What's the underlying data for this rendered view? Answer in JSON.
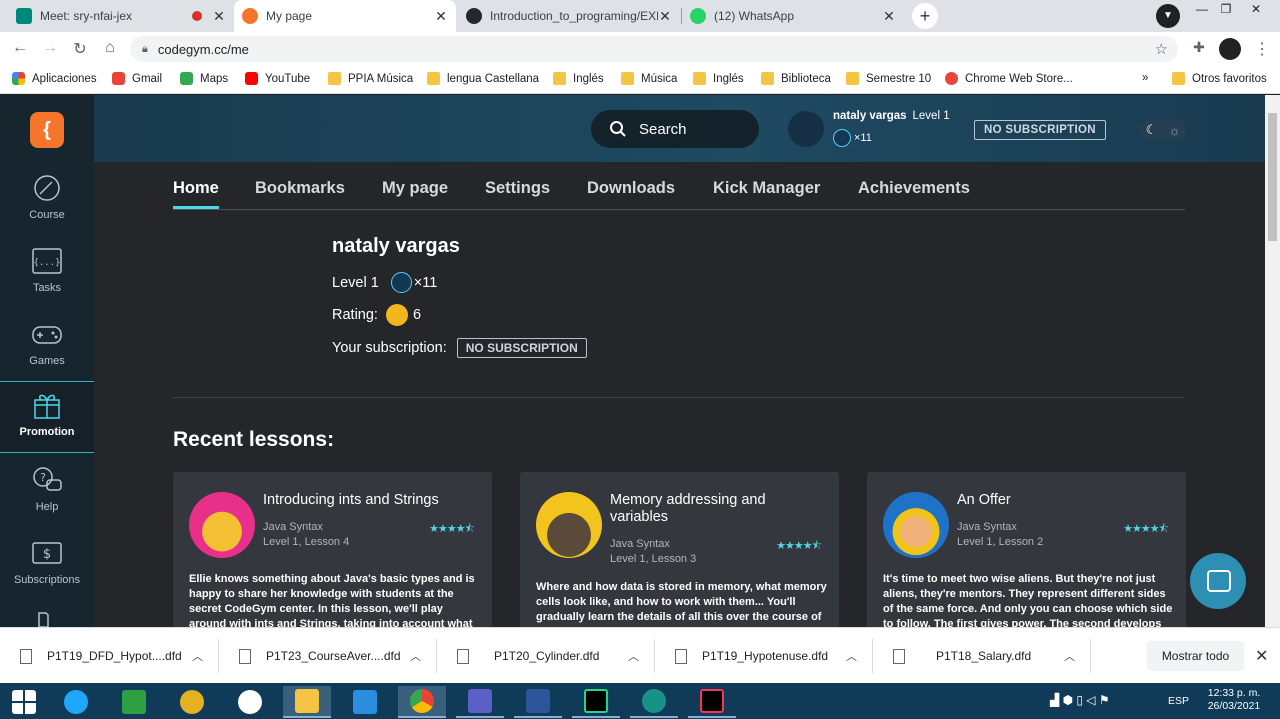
{
  "browser": {
    "tabs": [
      {
        "title": "Meet: sry-nfai-jex",
        "active": false
      },
      {
        "title": "My page",
        "active": true
      },
      {
        "title": "Introduction_to_programing/EXE",
        "active": false
      },
      {
        "title": "(12) WhatsApp",
        "active": false
      }
    ],
    "url": "codegym.cc/me",
    "bookmarks": [
      "Aplicaciones",
      "Gmail",
      "Maps",
      "YouTube",
      "PPIA Música",
      "lengua Castellana",
      "Inglés",
      "Música",
      "Inglés",
      "Biblioteca",
      "Semestre 10",
      "Chrome Web Store..."
    ],
    "more_bookmarks": "»",
    "other_bookmarks": "Otros favoritos"
  },
  "sidebar": {
    "logo": "{",
    "items": [
      {
        "label": "Course"
      },
      {
        "label": "Tasks"
      },
      {
        "label": "Games"
      },
      {
        "label": "Promotion"
      },
      {
        "label": "Help"
      },
      {
        "label": "Subscriptions"
      }
    ]
  },
  "header": {
    "search_label": "Search",
    "user_name": "nataly vargas",
    "user_level": "Level 1",
    "user_coins": "×11",
    "subscription": "NO SUBSCRIPTION"
  },
  "nav": {
    "tabs": [
      "Home",
      "Bookmarks",
      "My page",
      "Settings",
      "Downloads",
      "Kick Manager",
      "Achievements"
    ]
  },
  "profile": {
    "name": "nataly vargas",
    "level_label": "Level 1",
    "coins": "×11",
    "rating_label": "Rating:",
    "rating_value": "6",
    "subscription_label": "Your subscription:",
    "subscription_value": "NO SUBSCRIPTION"
  },
  "recent": {
    "title": "Recent lessons:",
    "lessons": [
      {
        "title": "Introducing ints and Strings",
        "course": "Java Syntax",
        "position": "Level 1, Lesson 4",
        "stars": "★★★★⯪",
        "description": "Ellie knows something about Java's basic types and is happy to share her knowledge with students at the secret CodeGym center. In this lesson, we'll play around with ints and Strings, taking into account what you previously"
      },
      {
        "title": "Memory addressing and variables",
        "course": "Java Syntax",
        "position": "Level 1, Lesson 3",
        "stars": "★★★★⯪",
        "description": "Where and how data is stored in memory, what memory cells look like, and how to work with them... You'll gradually learn the details of all this over the course of"
      },
      {
        "title": "An Offer",
        "course": "Java Syntax",
        "position": "Level 1, Lesson 2",
        "stars": "★★★★⯪",
        "description": "It's time to meet two wise aliens. But they're not just aliens, they're mentors. They represent different sides of the same force. And only you can choose which side to follow. The first gives power. The second develops"
      }
    ]
  },
  "downloads": {
    "files": [
      "P1T19_DFD_Hypot....dfd",
      "P1T23_CourseAver....dfd",
      "P1T20_Cylinder.dfd",
      "P1T19_Hypotenuse.dfd",
      "P1T18_Salary.dfd"
    ],
    "show_all": "Mostrar todo"
  },
  "taskbar": {
    "lang": "ESP",
    "time": "12:33 p. m.",
    "date": "26/03/2021"
  },
  "colors": {
    "accent": "#4fd6e6",
    "logo": "#f5762b",
    "header": "#1e4a62"
  }
}
